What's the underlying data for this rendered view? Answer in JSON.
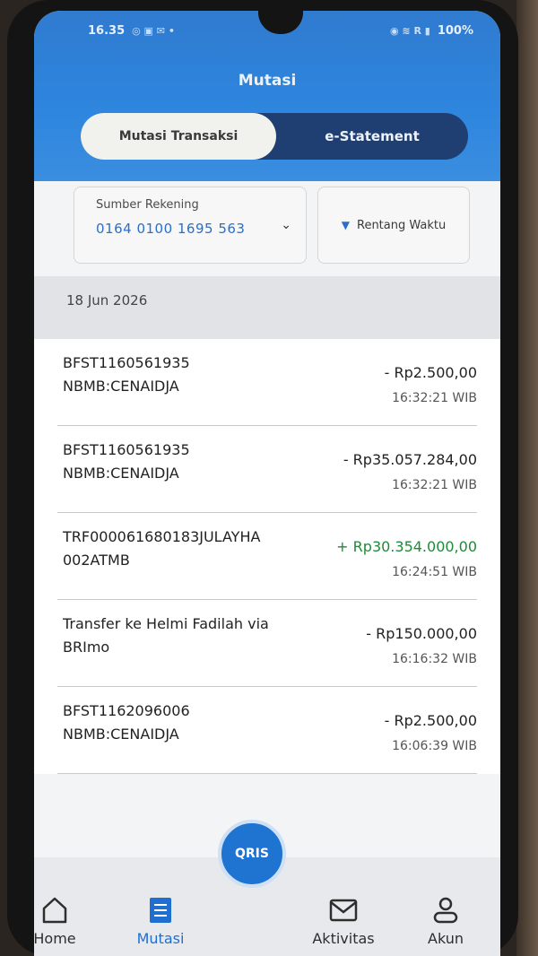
{
  "status": {
    "time": "16.35",
    "battery": "100%"
  },
  "header": {
    "title": "Mutasi"
  },
  "tabs": [
    {
      "label": "Mutasi Transaksi",
      "active": true
    },
    {
      "label": "e-Statement",
      "active": false
    }
  ],
  "filter": {
    "source_label": "Sumber Rekening",
    "source_value": "0164 0100 1695 563",
    "range_label": "Rentang Waktu"
  },
  "date_header": "18 Jun 2026",
  "transactions": [
    {
      "desc_line1": "BFST1160561935",
      "desc_line2": "NBMB:CENAIDJA",
      "amount": "- Rp2.500,00",
      "time": "16:32:21 WIB",
      "type": "debit"
    },
    {
      "desc_line1": "BFST1160561935",
      "desc_line2": "NBMB:CENAIDJA",
      "amount": "- Rp35.057.284,00",
      "time": "16:32:21 WIB",
      "type": "debit"
    },
    {
      "desc_line1": "TRF000061680183JULAYHA",
      "desc_line2": "002ATMB",
      "amount": "+ Rp30.354.000,00",
      "time": "16:24:51 WIB",
      "type": "credit"
    },
    {
      "desc_line1": "Transfer ke Helmi Fadilah via",
      "desc_line2": "BRImo",
      "amount": "- Rp150.000,00",
      "time": "16:16:32 WIB",
      "type": "debit"
    },
    {
      "desc_line1": "BFST1162096006",
      "desc_line2": "NBMB:CENAIDJA",
      "amount": "- Rp2.500,00",
      "time": "16:06:39 WIB",
      "type": "debit"
    }
  ],
  "nav": {
    "home": "Home",
    "mutasi": "Mutasi",
    "qris": "QRIS",
    "aktivitas": "Aktivitas",
    "akun": "Akun"
  },
  "colors": {
    "primary": "#2e86de",
    "credit": "#1f8a3a",
    "active_nav": "#1e6fcf"
  }
}
